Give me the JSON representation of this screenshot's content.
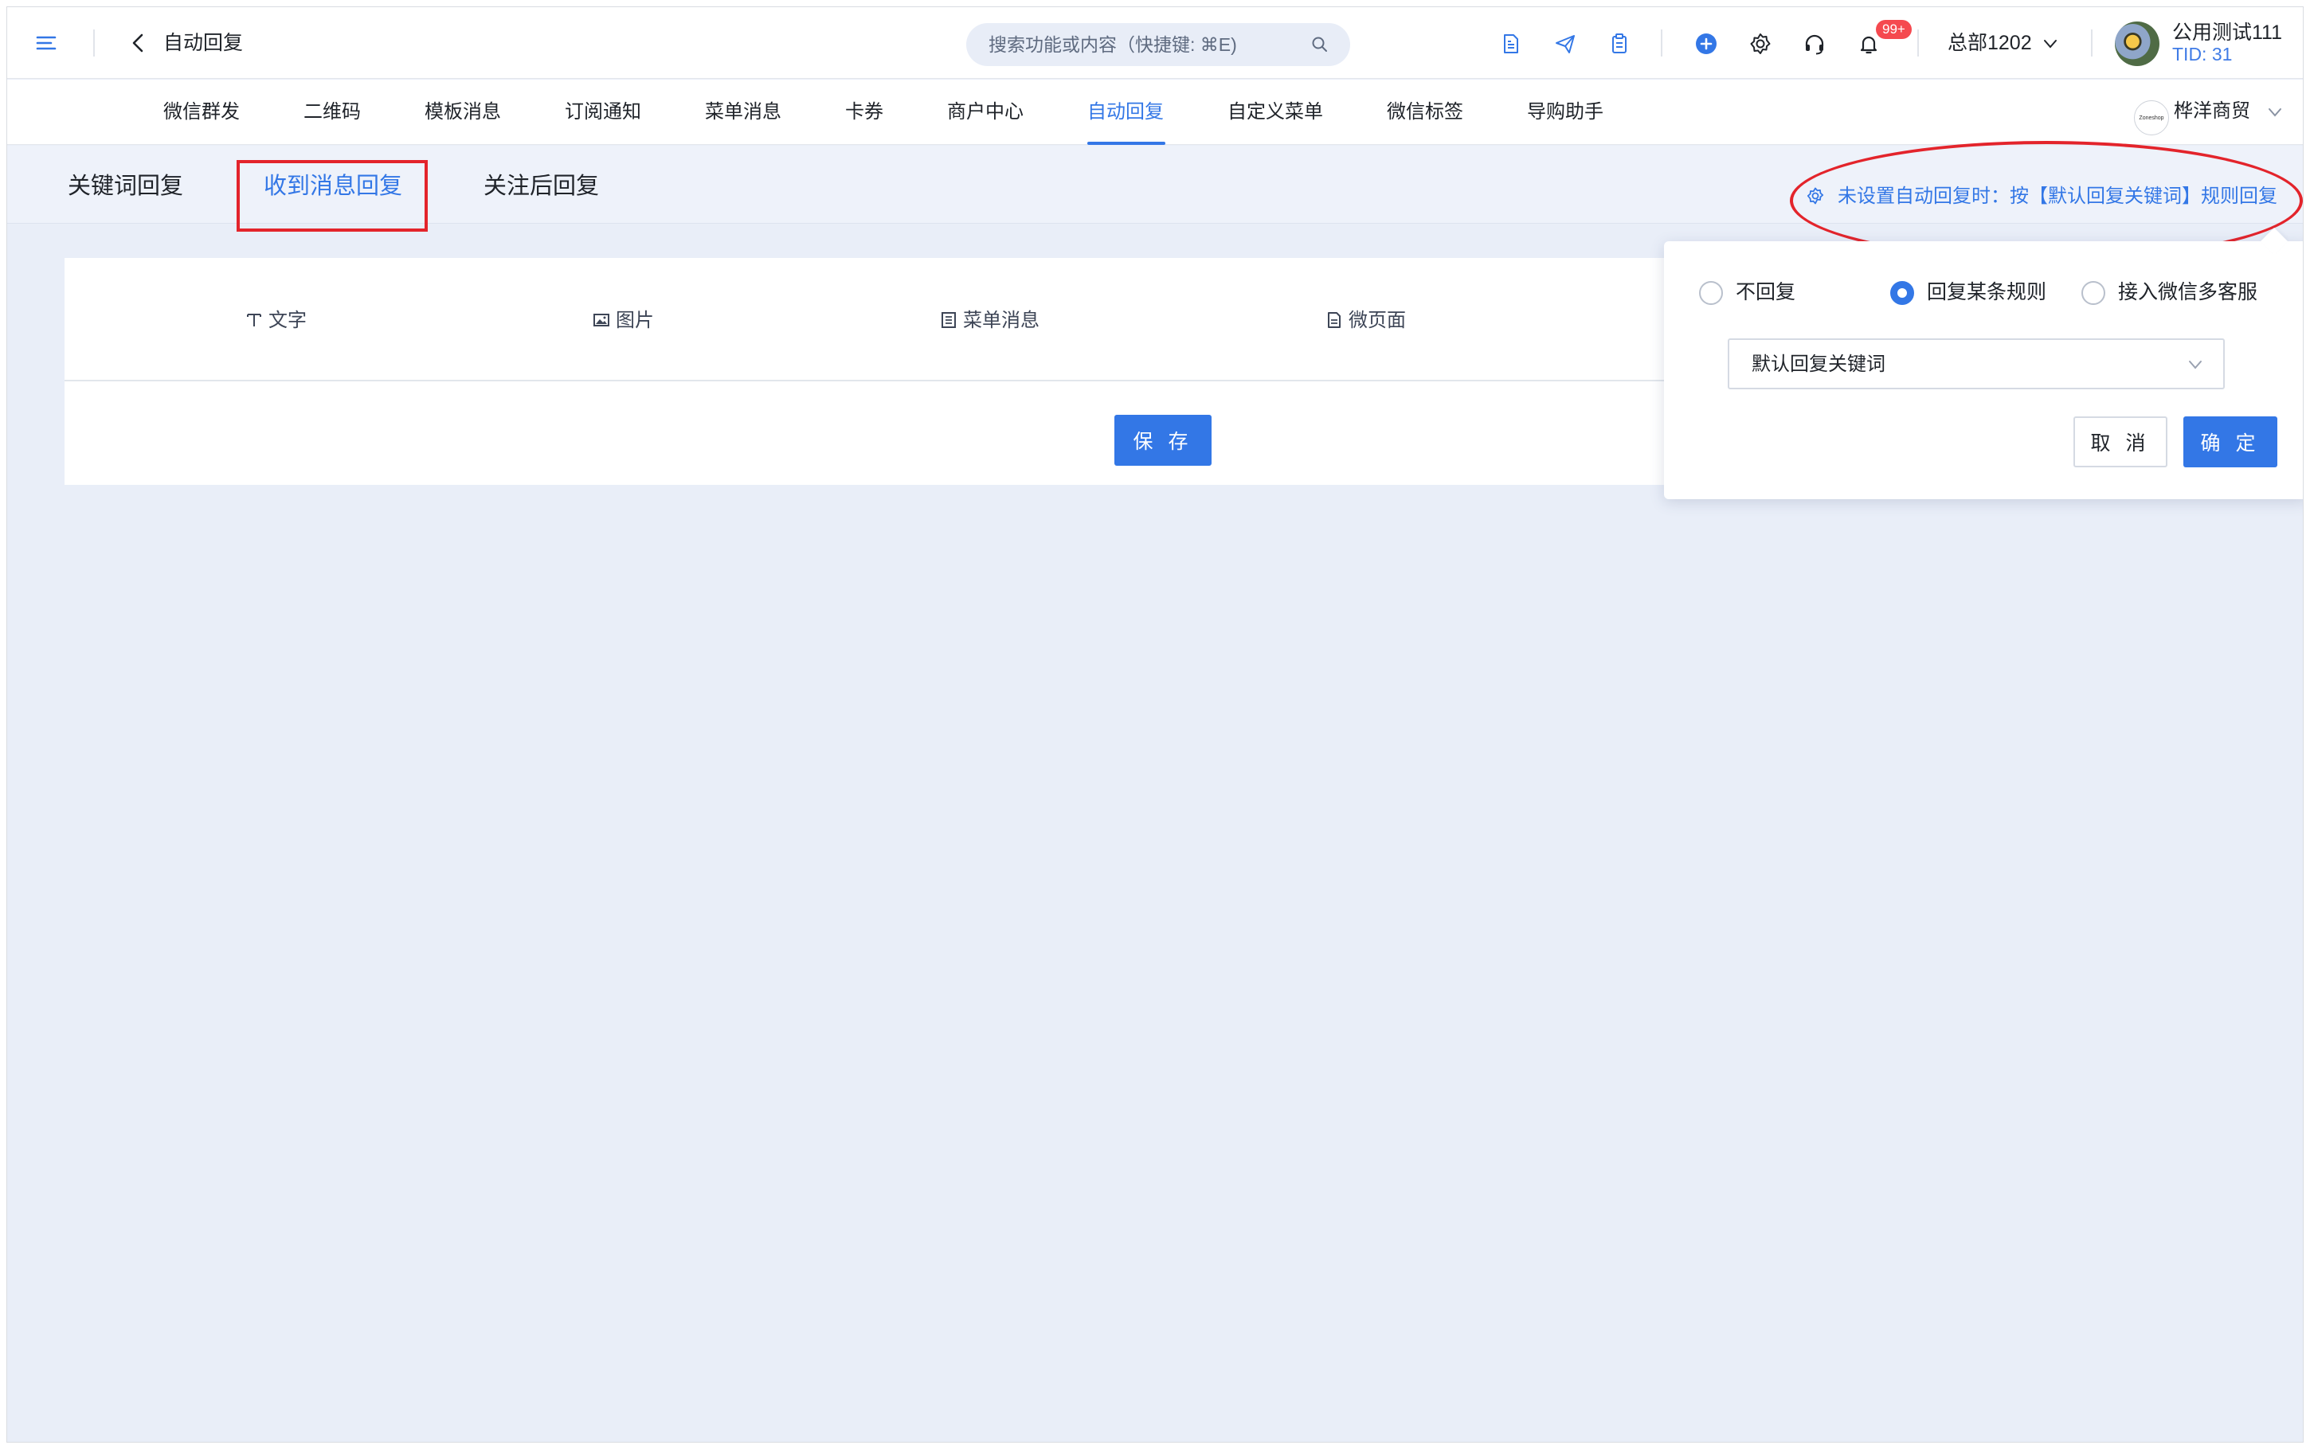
{
  "header": {
    "page_title": "自动回复",
    "search_placeholder": "搜索功能或内容（快捷键: ⌘E)",
    "notification_badge": "99+",
    "org_name": "总部1202",
    "user_name": "公用测试111",
    "user_tid": "TID: 31"
  },
  "nav": {
    "items": [
      "微信群发",
      "二维码",
      "模板消息",
      "订阅通知",
      "菜单消息",
      "卡券",
      "商户中心",
      "自动回复",
      "自定义菜单",
      "微信标签",
      "导购助手"
    ],
    "active_index": 7,
    "shop_name": "桦洋商贸",
    "shop_logo_text": "Zoneshop"
  },
  "subtabs": {
    "items": [
      "关键词回复",
      "收到消息回复",
      "关注后回复"
    ],
    "active_index": 1,
    "rule_link": "未设置自动回复时：按【默认回复关键词】规则回复"
  },
  "content": {
    "types": [
      "文字",
      "图片",
      "菜单消息",
      "微页面"
    ],
    "save_label": "保 存"
  },
  "popover": {
    "options": [
      "不回复",
      "回复某条规则",
      "接入微信多客服"
    ],
    "selected_index": 1,
    "select_value": "默认回复关键词",
    "cancel_label": "取 消",
    "ok_label": "确 定"
  },
  "colors": {
    "accent": "#3377e6",
    "annotation_red": "#e3242b",
    "badge_red": "#f5494f",
    "page_bg": "#e9eef8"
  },
  "icons": [
    "menu-icon",
    "back-chevron-icon",
    "search-icon",
    "document-icon",
    "send-icon",
    "clipboard-icon",
    "plus-circle-icon",
    "gear-icon",
    "headset-icon",
    "bell-icon",
    "chevron-down-icon",
    "text-icon",
    "image-icon",
    "list-icon",
    "page-icon"
  ]
}
